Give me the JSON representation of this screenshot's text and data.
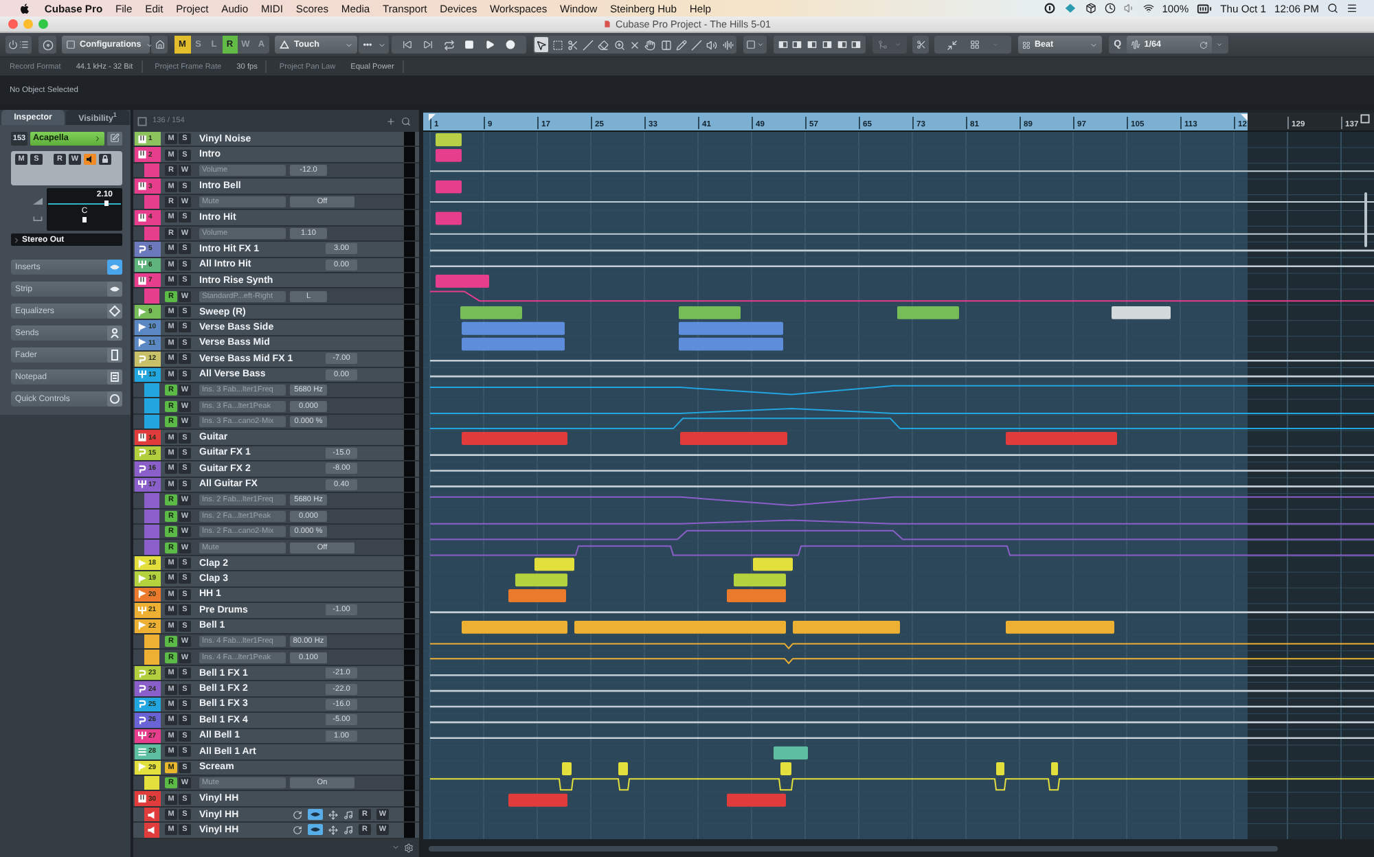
{
  "menu_bar": {
    "app_name": "Cubase Pro",
    "menus": [
      "File",
      "Edit",
      "Project",
      "Audio",
      "MIDI",
      "Scores",
      "Media",
      "Transport",
      "Devices",
      "Workspaces",
      "Window",
      "Steinberg Hub",
      "Help"
    ],
    "battery": "100%",
    "date": "Thu Oct 1",
    "time": "12:06 PM"
  },
  "window": {
    "title": "Cubase Pro Project - The Hills 5-01"
  },
  "toolbar": {
    "configurations": "Configurations",
    "automation_buttons": [
      {
        "label": "M",
        "on": true,
        "color": "#e2bd2c"
      },
      {
        "label": "S",
        "on": false
      },
      {
        "label": "L",
        "on": false
      },
      {
        "label": "R",
        "on": true,
        "color": "#62bb45"
      },
      {
        "label": "W",
        "on": false
      },
      {
        "label": "A",
        "on": false
      }
    ],
    "automation_mode": "Touch",
    "tools": [
      {
        "selected": true
      },
      {
        "selected": false
      },
      {
        "selected": false
      },
      {
        "selected": false
      },
      {
        "selected": false
      },
      {
        "selected": false
      },
      {
        "selected": false
      },
      {
        "selected": false
      },
      {
        "selected": false
      },
      {
        "selected": false
      },
      {
        "selected": false
      },
      {
        "selected": false
      },
      {
        "selected": false
      }
    ],
    "snap_type": "Beat",
    "quantize_label": "Q",
    "quantize": "1/64"
  },
  "info_line": [
    {
      "label": "Record Format",
      "value": "44.1 kHz - 32 Bit"
    },
    {
      "label": "Project Frame Rate",
      "value": "30 fps"
    },
    {
      "label": "Project Pan Law",
      "value": "Equal Power"
    }
  ],
  "status": "No Object Selected",
  "inspector": {
    "tabs": [
      {
        "label": "Inspector",
        "selected": true
      },
      {
        "label": "Visibility$^{1}$",
        "selected": false
      }
    ],
    "track_number": "153",
    "track_name": "Acapella",
    "buttons": [
      {
        "label": "M",
        "on": false
      },
      {
        "label": "S",
        "on": false
      },
      {
        "label": "R",
        "on": false
      },
      {
        "label": "W",
        "on": false
      }
    ],
    "monitor": true,
    "volume": {
      "reading": "2.10",
      "level": 0.8
    },
    "pan": {
      "reading": "C",
      "level": 0.5
    },
    "output": "Stereo Out",
    "sections": [
      {
        "label": "Inserts",
        "active": true
      },
      {
        "label": "Strip",
        "active": false
      },
      {
        "label": "Equalizers",
        "active": false
      },
      {
        "label": "Sends",
        "active": false
      },
      {
        "label": "Fader",
        "active": false
      },
      {
        "label": "Notepad",
        "active": false
      },
      {
        "label": "Quick Controls",
        "active": false
      }
    ]
  },
  "track_list": {
    "count": "136 / 154"
  },
  "tracks": [
    {
      "kind": "instrument",
      "number": "1",
      "name": "Vinyl Noise",
      "color": "#8cc35c",
      "buttons": [
        {
          "label": "M",
          "on": false
        },
        {
          "label": "S",
          "on": false
        }
      ]
    },
    {
      "kind": "instrument",
      "number": "2",
      "name": "Intro",
      "color": "#e63d8c",
      "buttons": [
        {
          "label": "M",
          "on": false
        },
        {
          "label": "S",
          "on": false
        }
      ],
      "children": [
        {
          "kind": "lane",
          "param": "Volume",
          "value": "-12.0",
          "buttons": [
            {
              "label": "R",
              "on": false
            },
            {
              "label": "W",
              "on": false
            }
          ]
        }
      ]
    },
    {
      "kind": "instrument",
      "number": "3",
      "name": "Intro Bell",
      "color": "#e63d8c",
      "buttons": [
        {
          "label": "M",
          "on": false
        },
        {
          "label": "S",
          "on": false
        }
      ],
      "children": [
        {
          "kind": "toggle",
          "param": "Mute",
          "value": "Off",
          "buttons": [
            {
              "label": "R",
              "on": false
            },
            {
              "label": "W",
              "on": false
            }
          ]
        }
      ]
    },
    {
      "kind": "instrument",
      "number": "4",
      "name": "Intro Hit",
      "color": "#e63d8c",
      "buttons": [
        {
          "label": "M",
          "on": false
        },
        {
          "label": "S",
          "on": false
        }
      ],
      "children": [
        {
          "kind": "lane",
          "param": "Volume",
          "value": "1.10",
          "buttons": [
            {
              "label": "R",
              "on": false
            },
            {
              "label": "W",
              "on": false
            }
          ]
        }
      ]
    },
    {
      "kind": "fx",
      "number": "5",
      "name": "Intro Hit FX 1",
      "color": "#6d79bd",
      "value": "3.00",
      "buttons": [
        {
          "label": "M",
          "on": false
        },
        {
          "label": "S",
          "on": false
        }
      ]
    },
    {
      "kind": "group",
      "number": "6",
      "name": "All Intro Hit",
      "color": "#5fb37c",
      "value": "0.00",
      "buttons": [
        {
          "label": "M",
          "on": false
        },
        {
          "label": "S",
          "on": false
        }
      ]
    },
    {
      "kind": "instrument",
      "number": "7",
      "name": "Intro Rise Synth",
      "color": "#e63d8c",
      "buttons": [
        {
          "label": "M",
          "on": false
        },
        {
          "label": "S",
          "on": false
        }
      ],
      "children": [
        {
          "kind": "lane",
          "param": "StandardP...eft-Right",
          "value": "L",
          "buttons": [
            {
              "label": "R",
              "on": true
            },
            {
              "label": "W",
              "on": false
            }
          ]
        }
      ]
    },
    {
      "kind": "audio",
      "number": "9",
      "name": "Sweep (R)",
      "color": "#76bd58",
      "buttons": [
        {
          "label": "M",
          "on": false
        },
        {
          "label": "S",
          "on": false
        }
      ]
    },
    {
      "kind": "audio",
      "number": "10",
      "name": "Verse Bass Side",
      "color": "#5b88c2",
      "buttons": [
        {
          "label": "M",
          "on": false
        },
        {
          "label": "S",
          "on": false
        }
      ]
    },
    {
      "kind": "audio",
      "number": "11",
      "name": "Verse Bass Mid",
      "color": "#5b88c2",
      "buttons": [
        {
          "label": "M",
          "on": false
        },
        {
          "label": "S",
          "on": false
        }
      ]
    },
    {
      "kind": "fx",
      "number": "12",
      "name": "Verse Bass Mid FX 1",
      "color": "#c9c06a",
      "value": "-7.00",
      "buttons": [
        {
          "label": "M",
          "on": false
        },
        {
          "label": "S",
          "on": false
        }
      ]
    },
    {
      "kind": "group",
      "number": "13",
      "name": "All Verse Bass",
      "color": "#22a6e0",
      "value": "0.00",
      "buttons": [
        {
          "label": "M",
          "on": false
        },
        {
          "label": "S",
          "on": false
        }
      ],
      "children": [
        {
          "kind": "lane",
          "param": "Ins. 3 Fab...lter1Freq",
          "value": "5680 Hz",
          "buttons": [
            {
              "label": "R",
              "on": true
            },
            {
              "label": "W",
              "on": false
            }
          ]
        },
        {
          "kind": "lane",
          "param": "Ins. 3 Fa...lter1Peak",
          "value": "0.000",
          "buttons": [
            {
              "label": "R",
              "on": true
            },
            {
              "label": "W",
              "on": false
            }
          ]
        },
        {
          "kind": "lane",
          "param": "Ins. 3 Fa...cano2-Mix",
          "value": "0.000 %",
          "buttons": [
            {
              "label": "R",
              "on": true
            },
            {
              "label": "W",
              "on": false
            }
          ]
        }
      ]
    },
    {
      "kind": "instrument",
      "number": "14",
      "name": "Guitar",
      "color": "#e03c3c",
      "buttons": [
        {
          "label": "M",
          "on": false
        },
        {
          "label": "S",
          "on": false
        }
      ]
    },
    {
      "kind": "fx",
      "number": "15",
      "name": "Guitar FX 1",
      "color": "#b4cf3e",
      "value": "-15.0",
      "buttons": [
        {
          "label": "M",
          "on": false
        },
        {
          "label": "S",
          "on": false
        }
      ]
    },
    {
      "kind": "fx",
      "number": "16",
      "name": "Guitar FX 2",
      "color": "#8b5fc9",
      "value": "-8.00",
      "buttons": [
        {
          "label": "M",
          "on": false
        },
        {
          "label": "S",
          "on": false
        }
      ]
    },
    {
      "kind": "group",
      "number": "17",
      "name": "All Guitar FX",
      "color": "#8b5fc9",
      "value": "0.40",
      "buttons": [
        {
          "label": "M",
          "on": false
        },
        {
          "label": "S",
          "on": false
        }
      ],
      "children": [
        {
          "kind": "lane",
          "param": "Ins. 2 Fab...lter1Freq",
          "value": "5680 Hz",
          "buttons": [
            {
              "label": "R",
              "on": true
            },
            {
              "label": "W",
              "on": false
            }
          ]
        },
        {
          "kind": "lane",
          "param": "Ins. 2 Fa...lter1Peak",
          "value": "0.000",
          "buttons": [
            {
              "label": "R",
              "on": true
            },
            {
              "label": "W",
              "on": false
            }
          ]
        },
        {
          "kind": "lane",
          "param": "Ins. 2 Fa...cano2-Mix",
          "value": "0.000 %",
          "buttons": [
            {
              "label": "R",
              "on": true
            },
            {
              "label": "W",
              "on": false
            }
          ]
        },
        {
          "kind": "toggle",
          "param": "Mute",
          "value": "Off",
          "buttons": [
            {
              "label": "R",
              "on": true
            },
            {
              "label": "W",
              "on": false
            }
          ]
        }
      ]
    },
    {
      "kind": "audio",
      "number": "18",
      "name": "Clap 2",
      "color": "#e3df3c",
      "buttons": [
        {
          "label": "M",
          "on": false
        },
        {
          "label": "S",
          "on": false
        }
      ]
    },
    {
      "kind": "audio",
      "number": "19",
      "name": "Clap 3",
      "color": "#b4d23e",
      "buttons": [
        {
          "label": "M",
          "on": false
        },
        {
          "label": "S",
          "on": false
        }
      ]
    },
    {
      "kind": "audio",
      "number": "20",
      "name": "HH 1",
      "color": "#ec7a2c",
      "buttons": [
        {
          "label": "M",
          "on": false
        },
        {
          "label": "S",
          "on": false
        }
      ]
    },
    {
      "kind": "group",
      "number": "21",
      "name": "Pre Drums",
      "color": "#eeb032",
      "value": "-1.00",
      "buttons": [
        {
          "label": "M",
          "on": false
        },
        {
          "label": "S",
          "on": false
        }
      ]
    },
    {
      "kind": "audio",
      "number": "22",
      "name": "Bell 1",
      "color": "#eeb032",
      "buttons": [
        {
          "label": "M",
          "on": false
        },
        {
          "label": "S",
          "on": false
        }
      ],
      "children": [
        {
          "kind": "lane",
          "param": "Ins. 4 Fab...lter1Freq",
          "value": "80.00 Hz",
          "buttons": [
            {
              "label": "R",
              "on": true
            },
            {
              "label": "W",
              "on": false
            }
          ]
        },
        {
          "kind": "lane",
          "param": "Ins. 4 Fa...lter1Peak",
          "value": "0.100",
          "buttons": [
            {
              "label": "R",
              "on": true
            },
            {
              "label": "W",
              "on": false
            }
          ]
        }
      ]
    },
    {
      "kind": "fx",
      "number": "23",
      "name": "Bell 1 FX 1",
      "color": "#b4cf3e",
      "value": "-21.0",
      "buttons": [
        {
          "label": "M",
          "on": false
        },
        {
          "label": "S",
          "on": false
        }
      ]
    },
    {
      "kind": "fx",
      "number": "24",
      "name": "Bell 1 FX 2",
      "color": "#8b5fc9",
      "value": "-22.0",
      "buttons": [
        {
          "label": "M",
          "on": false
        },
        {
          "label": "S",
          "on": false
        }
      ]
    },
    {
      "kind": "fx",
      "number": "25",
      "name": "Bell 1 FX 3",
      "color": "#22a6e0",
      "value": "-16.0",
      "buttons": [
        {
          "label": "M",
          "on": false
        },
        {
          "label": "S",
          "on": false
        }
      ]
    },
    {
      "kind": "fx",
      "number": "26",
      "name": "Bell 1 FX 4",
      "color": "#6a63d6",
      "value": "-5.00",
      "buttons": [
        {
          "label": "M",
          "on": false
        },
        {
          "label": "S",
          "on": false
        }
      ]
    },
    {
      "kind": "group",
      "number": "27",
      "name": "All Bell 1",
      "color": "#e63d8c",
      "value": "1.00",
      "buttons": [
        {
          "label": "M",
          "on": false
        },
        {
          "label": "S",
          "on": false
        }
      ]
    },
    {
      "kind": "list",
      "number": "28",
      "name": "All Bell 1 Art",
      "color": "#5cc0a0",
      "buttons": [
        {
          "label": "M",
          "on": false
        },
        {
          "label": "S",
          "on": false
        }
      ]
    },
    {
      "kind": "audio",
      "number": "29",
      "name": "Scream",
      "color": "#e3df3c",
      "buttons": [
        {
          "label": "M",
          "on": true
        },
        {
          "label": "S",
          "on": false
        }
      ],
      "children": [
        {
          "kind": "toggle",
          "param": "Mute",
          "value": "On",
          "buttons": [
            {
              "label": "R",
              "on": true
            },
            {
              "label": "W",
              "on": false
            }
          ]
        }
      ]
    },
    {
      "kind": "instrument",
      "number": "30",
      "name": "Vinyl HH",
      "color": "#e03c3c",
      "buttons": [
        {
          "label": "M",
          "on": false
        },
        {
          "label": "S",
          "on": false
        }
      ],
      "children": [
        {
          "kind": "sub",
          "name": "Vinyl HH",
          "buttons": [
            {
              "label": "M",
              "on": false
            },
            {
              "label": "S",
              "on": false
            }
          ],
          "visible": true,
          "tools": [
            "R",
            "W"
          ]
        },
        {
          "kind": "sub",
          "name": "Vinyl HH",
          "buttons": [
            {
              "label": "M",
              "on": false
            },
            {
              "label": "S",
              "on": false
            }
          ],
          "visible": true,
          "tools": [
            "R",
            "W"
          ]
        }
      ]
    }
  ],
  "ruler": {
    "marks": [
      "1",
      "9",
      "17",
      "25",
      "33",
      "41",
      "49",
      "57",
      "65",
      "73",
      "81",
      "89",
      "97",
      "105",
      "113",
      "12",
      "129",
      "137"
    ]
  }
}
